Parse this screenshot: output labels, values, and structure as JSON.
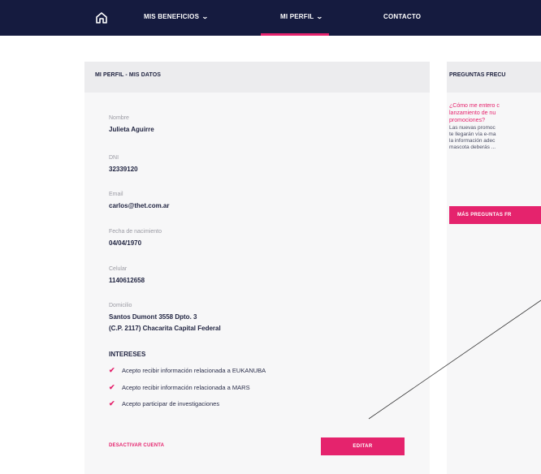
{
  "nav": {
    "items": [
      {
        "label": "MIS BENEFICIOS",
        "has_chevron": true
      },
      {
        "label": "MI PERFIL",
        "has_chevron": true,
        "active": true
      },
      {
        "label": "CONTACTO",
        "has_chevron": false
      }
    ],
    "home_icon": "home-icon",
    "chevron_icon": "chevron-down-icon"
  },
  "profile": {
    "title": "MI PERFIL - MIS DATOS",
    "fields": [
      {
        "label": "Nombre",
        "value": "Julieta Aguirre"
      },
      {
        "label": "DNI",
        "value": "32339120"
      },
      {
        "label": "Email",
        "value": "carlos@thet.com.ar"
      },
      {
        "label": "Fecha de nacimiento",
        "value": "04/04/1970"
      },
      {
        "label": "Celular",
        "value": "1140612658"
      },
      {
        "label": "Domicilio",
        "value": "Santos Dumont 3558 Dpto. 3",
        "value2": "(C.P. 2117) Chacarita Capital Federal"
      }
    ],
    "intereses_title": "INTERESES",
    "intereses": [
      "Acepto recibir información relacionada a EUKANUBA",
      "Acepto recibir información relacionada a MARS",
      "Acepto participar de investigaciones"
    ],
    "check_icon": "check-icon",
    "deactivate_label": "DESACTIVAR CUENTA",
    "edit_label": "EDITAR"
  },
  "faq": {
    "title": "PREGUNTAS FRECU",
    "question_lines": [
      "¿Cómo me entero c",
      "lanzamiento de nu",
      "promociones?"
    ],
    "answer_lines": [
      "Las nuevas promoc",
      "te llegarán vía e-ma",
      "la información adec",
      "mascota deberás ..."
    ],
    "button_label": "MÁS PREGUNTAS FR"
  },
  "colors": {
    "nav_bg": "#151b3f",
    "accent": "#e5236d",
    "card_bg": "#f7f7f8",
    "card_header_bg": "#ececee"
  }
}
